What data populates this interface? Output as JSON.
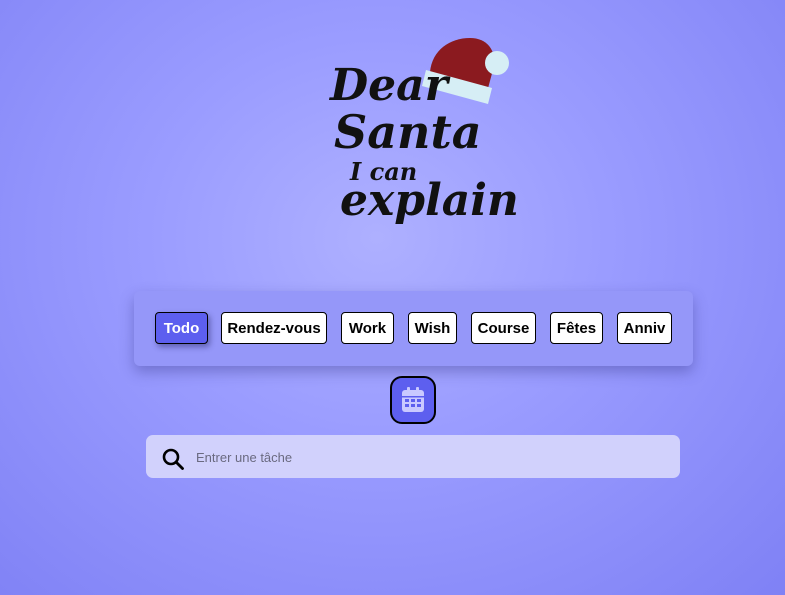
{
  "logo": {
    "line1": "Dear",
    "line2": "Santa",
    "line3": "I can",
    "line4": "explain",
    "icon": "santa-hat-icon"
  },
  "tabs": [
    {
      "label": "Todo",
      "active": true
    },
    {
      "label": "Rendez-vous",
      "active": false
    },
    {
      "label": "Work",
      "active": false
    },
    {
      "label": "Wish",
      "active": false
    },
    {
      "label": "Course",
      "active": false
    },
    {
      "label": "Fêtes",
      "active": false
    },
    {
      "label": "Anniv",
      "active": false
    }
  ],
  "calendar_button": {
    "icon": "calendar-icon"
  },
  "search": {
    "icon": "search-icon",
    "placeholder": "Entrer une tâche",
    "value": ""
  },
  "colors": {
    "accent": "#5d5fef",
    "panel": "#9597f9",
    "search_bg": "#d1d1fc",
    "hat_red": "#8b1a1f",
    "hat_trim": "#d6eef5"
  }
}
